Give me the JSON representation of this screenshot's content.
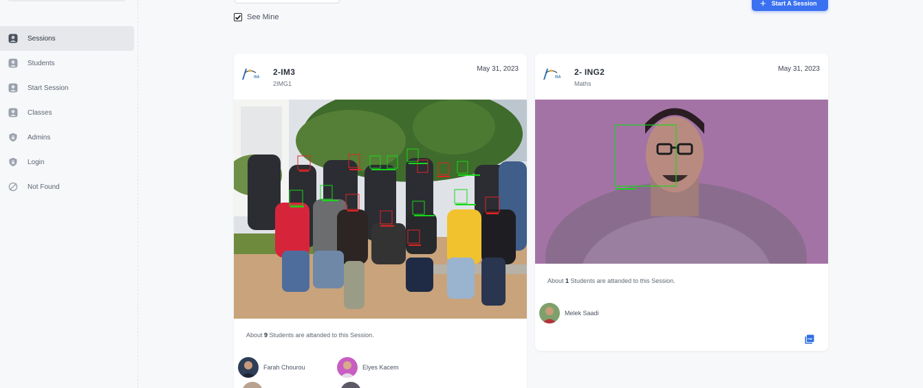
{
  "sidebar": {
    "items": [
      {
        "label": "Sessions",
        "icon": "user-icon",
        "active": true
      },
      {
        "label": "Students",
        "icon": "user-icon"
      },
      {
        "label": "Start Session",
        "icon": "user-icon"
      },
      {
        "label": "Classes",
        "icon": "user-icon"
      },
      {
        "label": "Admins",
        "icon": "lock-icon"
      },
      {
        "label": "Login",
        "icon": "lock-icon"
      },
      {
        "label": "Not Found",
        "icon": "not-found-icon"
      }
    ]
  },
  "toolbar": {
    "see_mine_label": "See Mine",
    "see_mine_checked": true,
    "start_button_label": "Start A Session"
  },
  "sessions": [
    {
      "title": "2-IM3",
      "subtitle": "2IMG1",
      "date": "May 31, 2023",
      "attend_prefix": "About ",
      "attend_count": "9",
      "attend_suffix": " Students are attanded to this Session.",
      "students": [
        "Farah Chourou",
        "Elyes Kacem"
      ]
    },
    {
      "title": "2- ING2",
      "subtitle": "Maths",
      "date": "May 31, 2023",
      "attend_prefix": "About ",
      "attend_count": "1",
      "attend_suffix": " Students are attanded to this Session.",
      "students": [
        "Melek Saadi"
      ]
    }
  ],
  "colors": {
    "accent": "#3a71f0",
    "face_known": "#19d619",
    "face_unknown": "#e02424"
  }
}
